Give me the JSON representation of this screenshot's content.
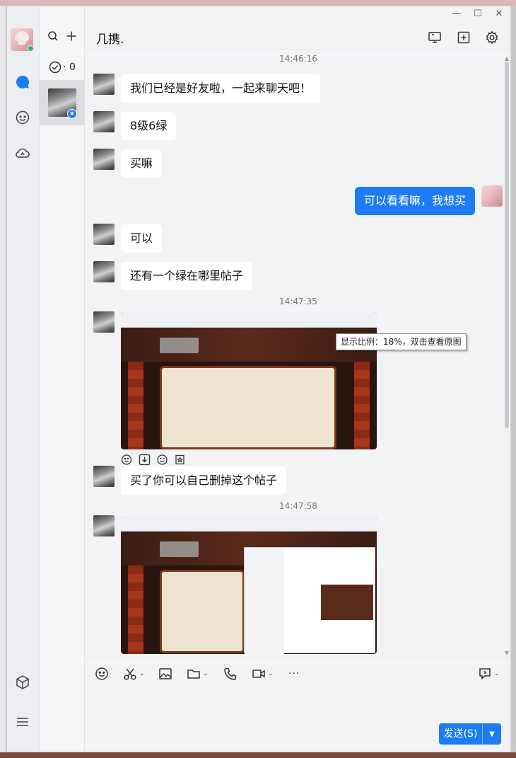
{
  "window": {
    "chat_title": "几携.",
    "controls": {
      "minimize": "—",
      "maximize": "☐",
      "close": "✕"
    }
  },
  "contacts": {
    "check_count": "· 0"
  },
  "messages": {
    "timestamps": [
      "14:46:16",
      "14:47:35",
      "14:47:58"
    ],
    "items": [
      {
        "from": "other",
        "text": "我们已经是好友啦，一起来聊天吧！"
      },
      {
        "from": "other",
        "text": "8级6绿"
      },
      {
        "from": "other",
        "text": "买嘛"
      },
      {
        "from": "me",
        "text": "可以看看嘛，我想买"
      },
      {
        "from": "other",
        "text": "可以"
      },
      {
        "from": "other",
        "text": "还有一个绿在哪里帖子"
      },
      {
        "from": "other",
        "text": "买了你可以自己删掉这个帖子"
      }
    ],
    "image_tooltip": "显示比例：18%，双击查看原图"
  },
  "composer": {
    "send_label": "发送(S)",
    "more_label": "···"
  },
  "colors": {
    "accent": "#1d7cf2",
    "online": "#1ec35e",
    "bubble_other": "#ffffff",
    "background": "#f2f3f5"
  },
  "icons": {
    "rail": [
      "chat-bubble-icon",
      "contacts-face-icon",
      "cloud-icon",
      "cube-icon",
      "menu-icon"
    ],
    "header": [
      "screen-share-icon",
      "add-group-icon",
      "settings-gear-icon"
    ],
    "toolbar": [
      "emoji-icon",
      "scissors-icon",
      "image-icon",
      "folder-icon",
      "phone-icon",
      "video-icon",
      "more-icon",
      "chat-history-icon"
    ],
    "image_actions": [
      "add-emoji-icon",
      "download-icon",
      "sticker-icon",
      "save-icon"
    ]
  }
}
